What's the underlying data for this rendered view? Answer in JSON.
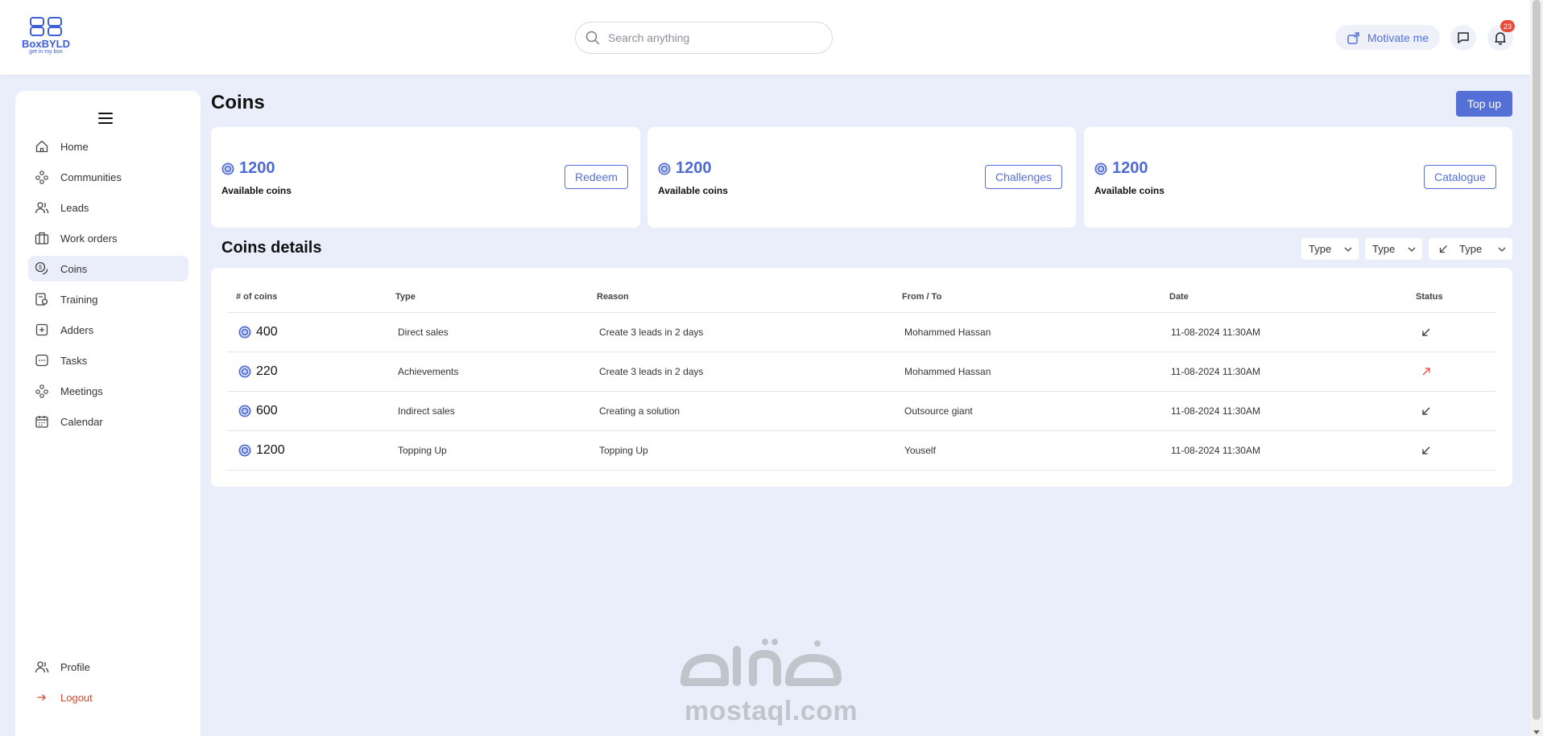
{
  "header": {
    "logo_name": "BoxBYLD",
    "logo_tagline": "get in my box",
    "search_placeholder": "Search anything",
    "motivate_label": "Motivate me",
    "notification_count": "23"
  },
  "sidebar": {
    "items": [
      {
        "label": "Home",
        "icon": "home-icon"
      },
      {
        "label": "Communities",
        "icon": "communities-icon"
      },
      {
        "label": "Leads",
        "icon": "leads-icon"
      },
      {
        "label": "Work orders",
        "icon": "briefcase-icon"
      },
      {
        "label": "Coins",
        "icon": "coins-icon",
        "active": true
      },
      {
        "label": "Training",
        "icon": "training-icon"
      },
      {
        "label": "Adders",
        "icon": "plus-square-icon"
      },
      {
        "label": "Tasks",
        "icon": "tasks-icon"
      },
      {
        "label": "Meetings",
        "icon": "meetings-icon"
      },
      {
        "label": "Calendar",
        "icon": "calendar-icon"
      }
    ],
    "profile_label": "Profile",
    "logout_label": "Logout"
  },
  "main": {
    "title": "Coins",
    "topup_label": "Top up",
    "cards": [
      {
        "amount": "1200",
        "label": "Available coins",
        "button": "Redeem"
      },
      {
        "amount": "1200",
        "label": "Available coins",
        "button": "Challenges"
      },
      {
        "amount": "1200",
        "label": "Available coins",
        "button": "Catalogue"
      }
    ],
    "details_title": "Coins details",
    "filters": [
      "Type",
      "Type",
      "Type"
    ],
    "table": {
      "headers": [
        "# of coins",
        "Type",
        "Reason",
        "From / To",
        "Date",
        "Status"
      ],
      "rows": [
        {
          "coins": "400",
          "type": "Direct sales",
          "reason": "Create 3 leads in 2 days",
          "from_to": "Mohammed Hassan",
          "date": "11-08-2024 11:30AM",
          "status": "incoming"
        },
        {
          "coins": "220",
          "type": "Achievements",
          "reason": "Create 3 leads in 2 days",
          "from_to": "Mohammed Hassan",
          "date": "11-08-2024 11:30AM",
          "status": "outgoing"
        },
        {
          "coins": "600",
          "type": "Indirect sales",
          "reason": "Creating a solution",
          "from_to": "Outsource giant",
          "date": "11-08-2024 11:30AM",
          "status": "incoming"
        },
        {
          "coins": "1200",
          "type": "Topping Up",
          "reason": "Topping Up",
          "from_to": "Youself",
          "date": "11-08-2024 11:30AM",
          "status": "incoming"
        }
      ]
    }
  },
  "watermark": {
    "text": "mostaql.com"
  },
  "colors": {
    "accent": "#5470d6",
    "incoming": "#333333",
    "outgoing": "#e84a3c",
    "logout": "#d34a2a"
  }
}
